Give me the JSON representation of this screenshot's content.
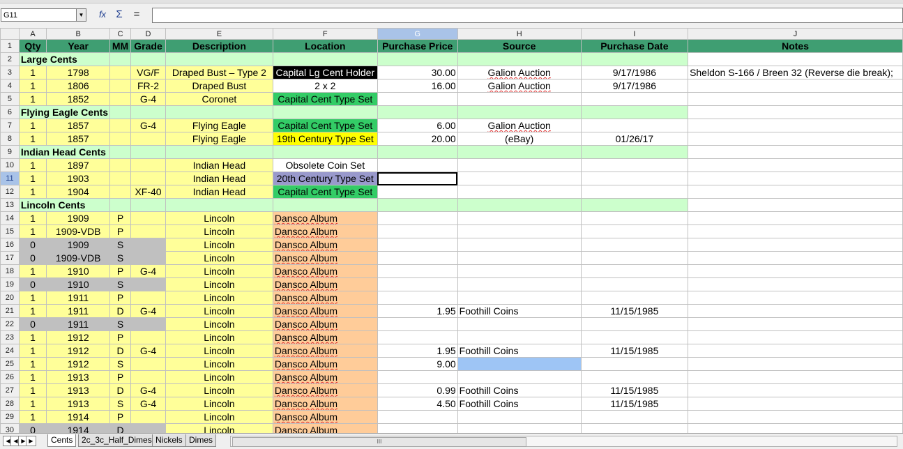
{
  "formula_bar": {
    "cell_ref": "G11",
    "dropdown_icon": "chevron-down-icon",
    "function_wizard_icon": "function-wizard-icon",
    "sum_icon": "sum-icon",
    "equals_icon": "equals-icon",
    "function_glyph": "fx",
    "sum_glyph": "Σ",
    "equals_glyph": "=",
    "formula_value": ""
  },
  "columns": [
    "A",
    "B",
    "C",
    "D",
    "E",
    "F",
    "G",
    "H",
    "I",
    "J"
  ],
  "selected_column": "G",
  "selected_row": 11,
  "header_row": {
    "row": 1,
    "cells": [
      "Qty",
      "Year",
      "MM",
      "Grade",
      "Description",
      "Location",
      "Purchase Price",
      "Source",
      "Purchase Date",
      "Notes"
    ]
  },
  "rows": [
    {
      "n": 2,
      "type": "category",
      "label": "Large Cents"
    },
    {
      "n": 3,
      "qty": "1",
      "year": "1798",
      "mm": "",
      "grade": "VG/F",
      "desc": "Draped Bust – Type 2",
      "loc": "Capital Lg Cent Holder",
      "loc_style": "black",
      "price": "30.00",
      "source": "Galion Auction",
      "date": "9/17/1986",
      "notes": "Sheldon S-166 / Breen 32 (Reverse die break);"
    },
    {
      "n": 4,
      "qty": "1",
      "year": "1806",
      "mm": "",
      "grade": "FR-2",
      "desc": "Draped Bust",
      "loc": "2 x 2",
      "loc_style": "plain",
      "price": "16.00",
      "source": "Galion Auction",
      "date": "9/17/1986",
      "notes": ""
    },
    {
      "n": 5,
      "qty": "1",
      "year": "1852",
      "mm": "",
      "grade": "G-4",
      "desc": "Coronet",
      "loc": "Capital Cent Type Set",
      "loc_style": "green",
      "price": "",
      "source": "",
      "date": "",
      "notes": ""
    },
    {
      "n": 6,
      "type": "category",
      "label": "Flying Eagle Cents"
    },
    {
      "n": 7,
      "qty": "1",
      "year": "1857",
      "mm": "",
      "grade": "G-4",
      "desc": "Flying Eagle",
      "loc": "Capital Cent Type Set",
      "loc_style": "green",
      "price": "6.00",
      "source": "Galion Auction",
      "date": "",
      "notes": ""
    },
    {
      "n": 8,
      "qty": "1",
      "year": "1857",
      "mm": "",
      "grade": "",
      "desc": "Flying Eagle",
      "loc": "19th Century Type Set",
      "loc_style": "yellow",
      "price": "20.00",
      "source": "(eBay)",
      "date": "01/26/17",
      "notes": ""
    },
    {
      "n": 9,
      "type": "category",
      "label": "Indian Head Cents"
    },
    {
      "n": 10,
      "qty": "1",
      "year": "1897",
      "mm": "",
      "grade": "",
      "desc": "Indian Head",
      "loc": "Obsolete Coin Set",
      "loc_style": "plain",
      "price": "",
      "source": "",
      "date": "",
      "notes": ""
    },
    {
      "n": 11,
      "qty": "1",
      "year": "1903",
      "mm": "",
      "grade": "",
      "desc": "Indian Head",
      "loc": "20th Century Type Set",
      "loc_style": "purple",
      "price": "",
      "source": "",
      "date": "",
      "notes": ""
    },
    {
      "n": 12,
      "qty": "1",
      "year": "1904",
      "mm": "",
      "grade": "XF-40",
      "desc": "Indian Head",
      "loc": "Capital Cent Type Set",
      "loc_style": "green",
      "price": "",
      "source": "",
      "date": "",
      "notes": ""
    },
    {
      "n": 13,
      "type": "category",
      "label": "Lincoln Cents"
    },
    {
      "n": 14,
      "qty": "1",
      "year": "1909",
      "mm": "P",
      "grade": "",
      "desc": "Lincoln",
      "loc": "Dansco Album",
      "loc_style": "orange",
      "price": "",
      "source": "",
      "date": "",
      "notes": ""
    },
    {
      "n": 15,
      "qty": "1",
      "year": "1909-VDB",
      "mm": "P",
      "grade": "",
      "desc": "Lincoln",
      "loc": "Dansco Album",
      "loc_style": "orange",
      "price": "",
      "source": "",
      "date": "",
      "notes": ""
    },
    {
      "n": 16,
      "qty": "0",
      "year": "1909",
      "mm": "S",
      "grade": "",
      "desc": "Lincoln",
      "loc": "Dansco Album",
      "loc_style": "orange",
      "price": "",
      "source": "",
      "date": "",
      "notes": "",
      "missing": true
    },
    {
      "n": 17,
      "qty": "0",
      "year": "1909-VDB",
      "mm": "S",
      "grade": "",
      "desc": "Lincoln",
      "loc": "Dansco Album",
      "loc_style": "orange",
      "price": "",
      "source": "",
      "date": "",
      "notes": "",
      "missing": true
    },
    {
      "n": 18,
      "qty": "1",
      "year": "1910",
      "mm": "P",
      "grade": "G-4",
      "desc": "Lincoln",
      "loc": "Dansco Album",
      "loc_style": "orange",
      "price": "",
      "source": "",
      "date": "",
      "notes": ""
    },
    {
      "n": 19,
      "qty": "0",
      "year": "1910",
      "mm": "S",
      "grade": "",
      "desc": "Lincoln",
      "loc": "Dansco Album",
      "loc_style": "orange",
      "price": "",
      "source": "",
      "date": "",
      "notes": "",
      "missing": true
    },
    {
      "n": 20,
      "qty": "1",
      "year": "1911",
      "mm": "P",
      "grade": "",
      "desc": "Lincoln",
      "loc": "Dansco Album",
      "loc_style": "orange",
      "price": "",
      "source": "",
      "date": "",
      "notes": ""
    },
    {
      "n": 21,
      "qty": "1",
      "year": "1911",
      "mm": "D",
      "grade": "G-4",
      "desc": "Lincoln",
      "loc": "Dansco Album",
      "loc_style": "orange",
      "price": "1.95",
      "source": "Foothill Coins",
      "date": "11/15/1985",
      "notes": ""
    },
    {
      "n": 22,
      "qty": "0",
      "year": "1911",
      "mm": "S",
      "grade": "",
      "desc": "Lincoln",
      "loc": "Dansco Album",
      "loc_style": "orange",
      "price": "",
      "source": "",
      "date": "",
      "notes": "",
      "missing": true
    },
    {
      "n": 23,
      "qty": "1",
      "year": "1912",
      "mm": "P",
      "grade": "",
      "desc": "Lincoln",
      "loc": "Dansco Album",
      "loc_style": "orange",
      "price": "",
      "source": "",
      "date": "",
      "notes": ""
    },
    {
      "n": 24,
      "qty": "1",
      "year": "1912",
      "mm": "D",
      "grade": "G-4",
      "desc": "Lincoln",
      "loc": "Dansco Album",
      "loc_style": "orange",
      "price": "1.95",
      "source": "Foothill Coins",
      "date": "11/15/1985",
      "notes": ""
    },
    {
      "n": 25,
      "qty": "1",
      "year": "1912",
      "mm": "S",
      "grade": "",
      "desc": "Lincoln",
      "loc": "Dansco Album",
      "loc_style": "orange",
      "price": "9.00",
      "source": "",
      "date": "",
      "notes": "",
      "source_blue": true
    },
    {
      "n": 26,
      "qty": "1",
      "year": "1913",
      "mm": "P",
      "grade": "",
      "desc": "Lincoln",
      "loc": "Dansco Album",
      "loc_style": "orange",
      "price": "",
      "source": "",
      "date": "",
      "notes": ""
    },
    {
      "n": 27,
      "qty": "1",
      "year": "1913",
      "mm": "D",
      "grade": "G-4",
      "desc": "Lincoln",
      "loc": "Dansco Album",
      "loc_style": "orange",
      "price": "0.99",
      "source": "Foothill Coins",
      "date": "11/15/1985",
      "notes": ""
    },
    {
      "n": 28,
      "qty": "1",
      "year": "1913",
      "mm": "S",
      "grade": "G-4",
      "desc": "Lincoln",
      "loc": "Dansco Album",
      "loc_style": "orange",
      "price": "4.50",
      "source": "Foothill Coins",
      "date": "11/15/1985",
      "notes": ""
    },
    {
      "n": 29,
      "qty": "1",
      "year": "1914",
      "mm": "P",
      "grade": "",
      "desc": "Lincoln",
      "loc": "Dansco Album",
      "loc_style": "orange",
      "price": "",
      "source": "",
      "date": "",
      "notes": ""
    },
    {
      "n": 30,
      "qty": "0",
      "year": "1914",
      "mm": "D",
      "grade": "",
      "desc": "Lincoln",
      "loc": "Dansco Album",
      "loc_style": "orange",
      "price": "",
      "source": "",
      "date": "",
      "notes": "",
      "missing": true
    }
  ],
  "sheet_tabs": {
    "nav_icons": [
      "first-sheet-icon",
      "prev-sheet-icon",
      "next-sheet-icon",
      "last-sheet-icon"
    ],
    "nav_glyphs": [
      "◀",
      "◀",
      "▶",
      "▶"
    ],
    "tabs": [
      "Cents",
      "2c_3c_Half_Dimes",
      "Nickels",
      "Dimes"
    ],
    "active": "Cents",
    "scroll_glyph": "III"
  },
  "colors": {
    "header_green": "#3f9e72",
    "category_green": "#ccffcc",
    "owned_yellow": "#ffff99",
    "missing_gray": "#c0c0c0",
    "album_orange": "#ffcc99"
  }
}
